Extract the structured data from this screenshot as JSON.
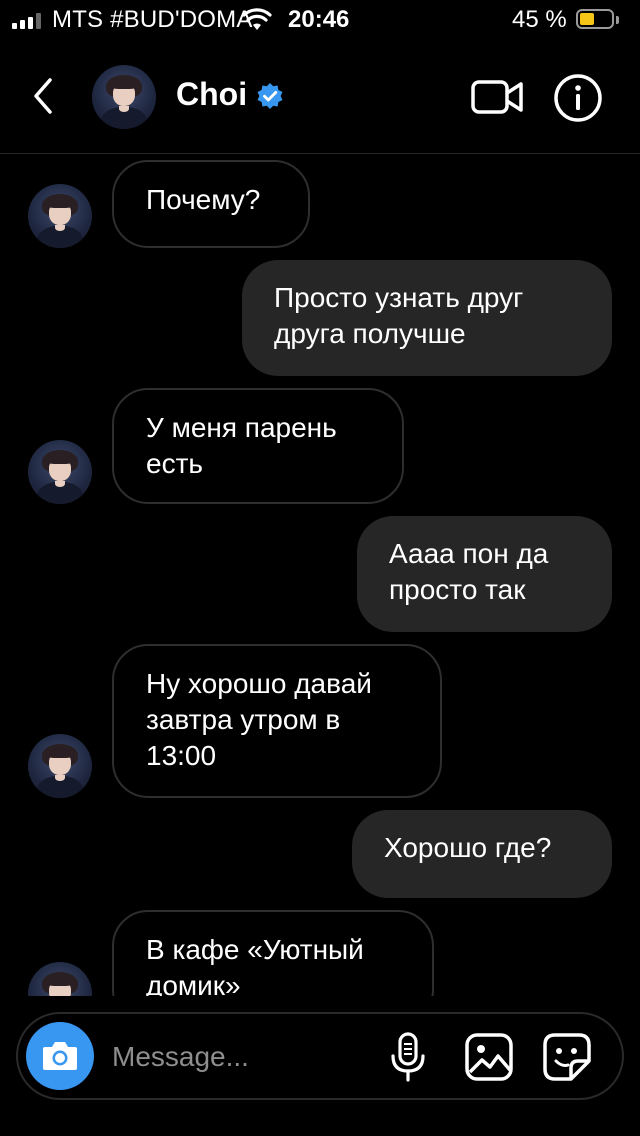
{
  "status_bar": {
    "carrier": "MTS #BUD'DOMA",
    "time": "20:46",
    "battery_percent": "45 %",
    "battery_level": 0.45,
    "icons": [
      "signal-icon",
      "wifi-icon",
      "battery-icon"
    ]
  },
  "header": {
    "contact_name": "Choi",
    "verified": true,
    "icons": [
      "back-chevron-icon",
      "avatar",
      "verified-badge-icon",
      "video-camera-icon",
      "info-icon"
    ]
  },
  "colors": {
    "background": "#000000",
    "outgoing_bubble": "#262626",
    "incoming_border": "#2e2e2e",
    "verified_blue": "#3897f0",
    "camera_button": "#3897f0",
    "battery_fill": "#f5c518",
    "placeholder": "#8e8e8e"
  },
  "messages": [
    {
      "direction": "in",
      "text": "Почему?"
    },
    {
      "direction": "out",
      "text": "Просто узнать друг друга получше"
    },
    {
      "direction": "in",
      "text": "У меня парень есть"
    },
    {
      "direction": "out",
      "text": "Аааа пон да просто так"
    },
    {
      "direction": "in",
      "text": "Ну хорошо давай завтра утром в 13:00"
    },
    {
      "direction": "out",
      "text": "Хорошо где?"
    },
    {
      "direction": "in",
      "text": "В кафе «Уютный домик»"
    }
  ],
  "composer": {
    "placeholder": "Message...",
    "icons": [
      "camera-icon",
      "microphone-icon",
      "gallery-icon",
      "sticker-icon"
    ]
  }
}
